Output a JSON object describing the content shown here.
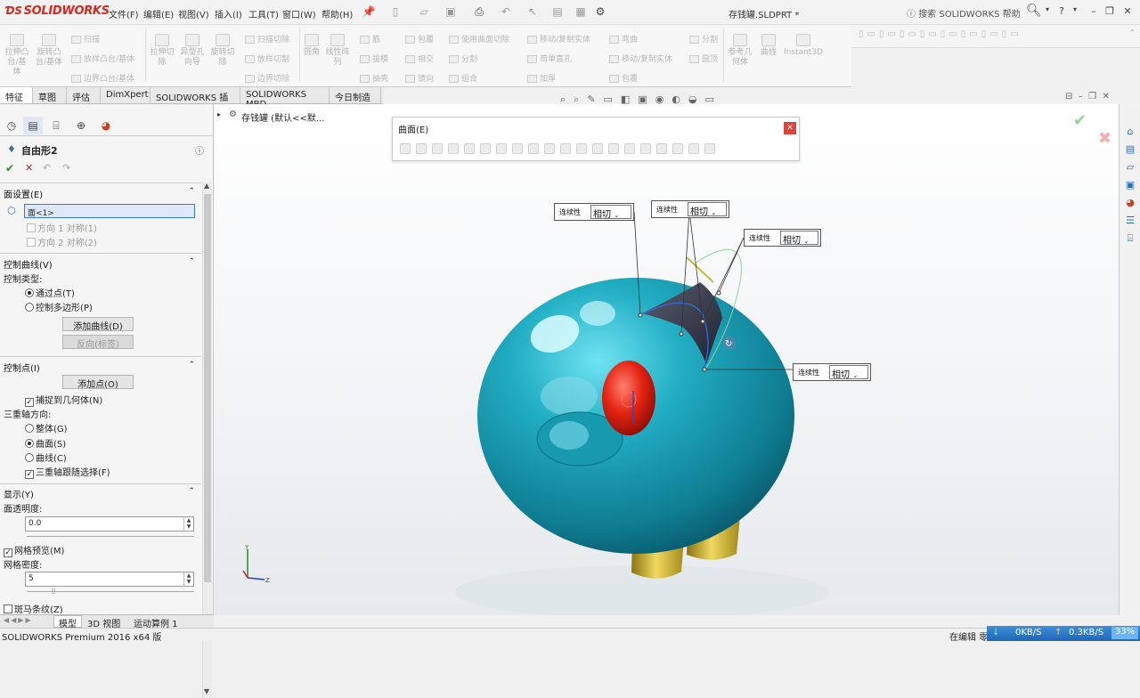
{
  "app": {
    "logo": "SOLIDWORKS",
    "doc_title": "存钱罐.SLDPRT *",
    "search_placeholder": "搜索 SOLIDWORKS 帮助"
  },
  "menu": [
    "文件(F)",
    "编辑(E)",
    "视图(V)",
    "插入(I)",
    "工具(T)",
    "窗口(W)",
    "帮助(H)"
  ],
  "commands": {
    "col1": [
      "拉伸凸台/基体",
      "旋转凸台/基体"
    ],
    "rows1": [
      "扫描",
      "放样凸台/基体",
      "边界凸台/基体"
    ],
    "col2": [
      "拉伸切除",
      "异型孔向导",
      "旋转切除"
    ],
    "rows2": [
      "扫描切除",
      "放样切割",
      "边界切除"
    ],
    "col3": [
      "圆角",
      "线性阵列"
    ],
    "rows3a": [
      "筋",
      "拔模",
      "抽壳"
    ],
    "rows3b": [
      "包覆",
      "相交",
      "镜向"
    ],
    "rows3c": [
      "使用曲面切除",
      "分割",
      "组合"
    ],
    "rows3d": [
      "移动/复制实体",
      "简单直孔",
      "加厚"
    ],
    "rows3e": [
      "弯曲",
      "移动/复制实体",
      "包覆"
    ],
    "rows3f": [
      "分割",
      "圆顶"
    ],
    "col4": [
      "参考几何体",
      "曲线",
      "Instant3D"
    ]
  },
  "tabs": [
    "特征",
    "草图",
    "评估",
    "DimXpert",
    "SOLIDWORKS 插件",
    "SOLIDWORKS MBD",
    "今日制造"
  ],
  "tree_item": "存钱罐 (默认<<默...",
  "property_manager": {
    "title": "自由形2",
    "face_settings": {
      "header": "面设置(E)",
      "face": "面<1>",
      "dir1": "方向 1 对称(1)",
      "dir2": "方向 2 对称(2)"
    },
    "control_curves": {
      "header": "控制曲线(V)",
      "type_label": "控制类型:",
      "through_points": "通过点(T)",
      "control_polygon": "控制多边形(P)",
      "add_curve": "添加曲线(D)",
      "reverse": "反向(标签)"
    },
    "control_points": {
      "header": "控制点(I)",
      "add_point": "添加点(O)",
      "snap": "捕捉到几何体(N)",
      "triad_label": "三重轴方向:",
      "global": "整体(G)",
      "surface": "曲面(S)",
      "curve": "曲线(C)",
      "follow": "三重轴跟随选择(F)"
    },
    "display": {
      "header": "显示(Y)",
      "transparency_label": "面透明度:",
      "transparency": "0.0",
      "mesh_preview": "网格预览(M)",
      "mesh_density_label": "网格密度:",
      "mesh_density": "5",
      "zebra": "斑马条纹(Z)"
    }
  },
  "surface_popup": {
    "title": "曲面(E)"
  },
  "callouts": [
    {
      "label": "连续性",
      "value": "相切"
    },
    {
      "label": "连续性",
      "value": "相切"
    },
    {
      "label": "连续性",
      "value": "相切"
    },
    {
      "label": "连续性",
      "value": "相切"
    }
  ],
  "bottom_tabs": [
    "模型",
    "3D 视图",
    "运动算例 1"
  ],
  "status": {
    "version": "SOLIDWORKS Premium 2016 x64 版",
    "editing": "在编辑 零件",
    "down": "0KB/S",
    "up": "0.3KB/S",
    "cpu": "33%"
  },
  "colors": {
    "body": "#1f9fb4",
    "eye": "#e02010",
    "legs": "#d8b830",
    "accent": "#1e66b8"
  }
}
